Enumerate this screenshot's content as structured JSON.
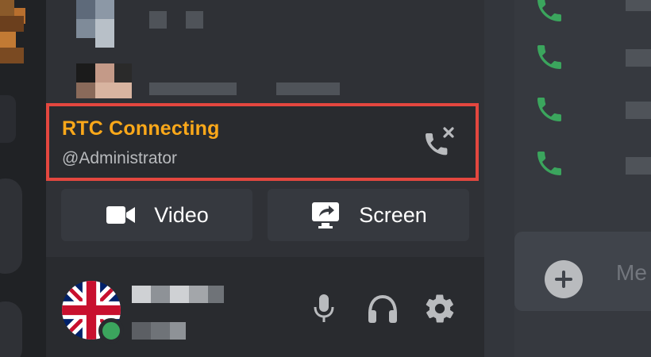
{
  "voice_panel": {
    "status": "RTC Connecting",
    "channel": "@Administrator"
  },
  "actions": {
    "video_label": "Video",
    "screen_label": "Screen"
  },
  "composer": {
    "placeholder": "Me"
  },
  "colors": {
    "status_text": "#faa81a",
    "highlight_border": "#e4473f",
    "online_dot": "#3ba55d",
    "call_icon": "#3ba55d"
  },
  "icons": [
    "video-camera-icon",
    "screen-share-icon",
    "disconnect-call-icon",
    "microphone-icon",
    "headphones-icon",
    "settings-gear-icon",
    "phone-call-icon",
    "add-icon"
  ]
}
